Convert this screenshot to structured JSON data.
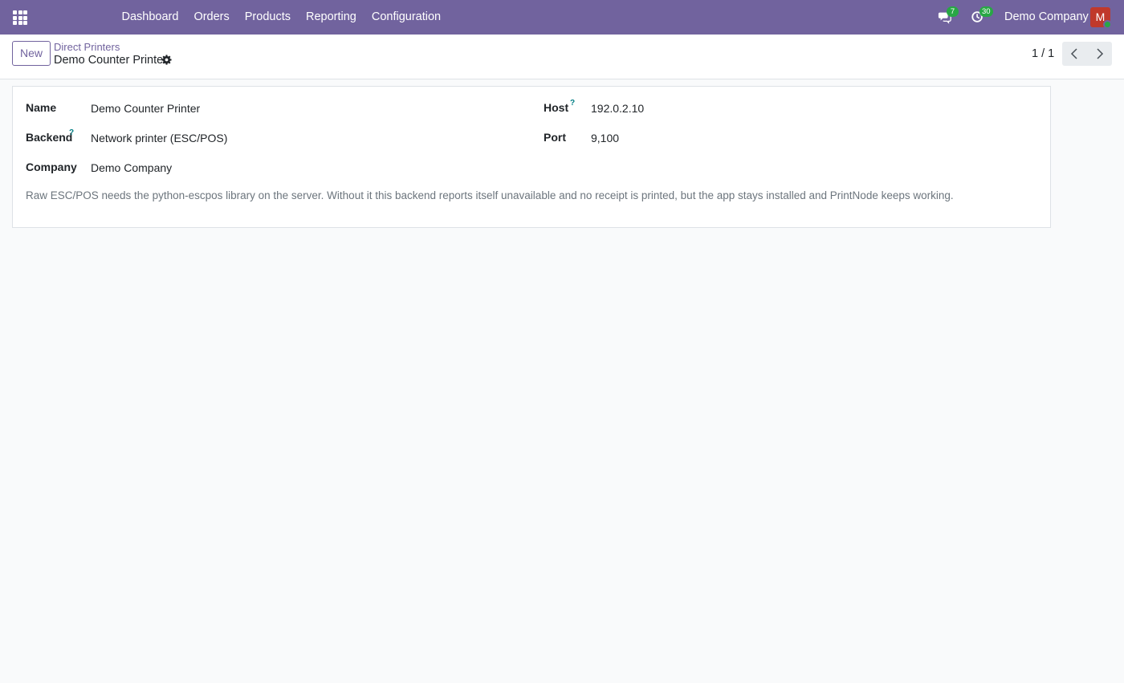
{
  "navbar": {
    "menu": [
      "Dashboard",
      "Orders",
      "Products",
      "Reporting",
      "Configuration"
    ],
    "messages_count": "7",
    "activities_count": "30",
    "company": "Demo Company",
    "avatar_letter": "M",
    "brand_color": "#71639e"
  },
  "control_panel": {
    "new_label": "New",
    "breadcrumb_parent": "Direct Printers",
    "breadcrumb_current": "Demo Counter Printer",
    "pager": "1 / 1"
  },
  "form": {
    "name_label": "Name",
    "name_value": "Demo Counter Printer",
    "backend_label": "Backend",
    "backend_value": "Network printer (ESC/POS)",
    "company_label": "Company",
    "company_value": "Demo Company",
    "host_label": "Host",
    "host_value": "192.0.2.10",
    "port_label": "Port",
    "port_value": "9,100",
    "help_mark": "?",
    "note": "Raw ESC/POS needs the python-escpos library on the server. Without it this backend reports itself unavailable and no receipt is printed, but the app stays installed and PrintNode keeps working."
  }
}
